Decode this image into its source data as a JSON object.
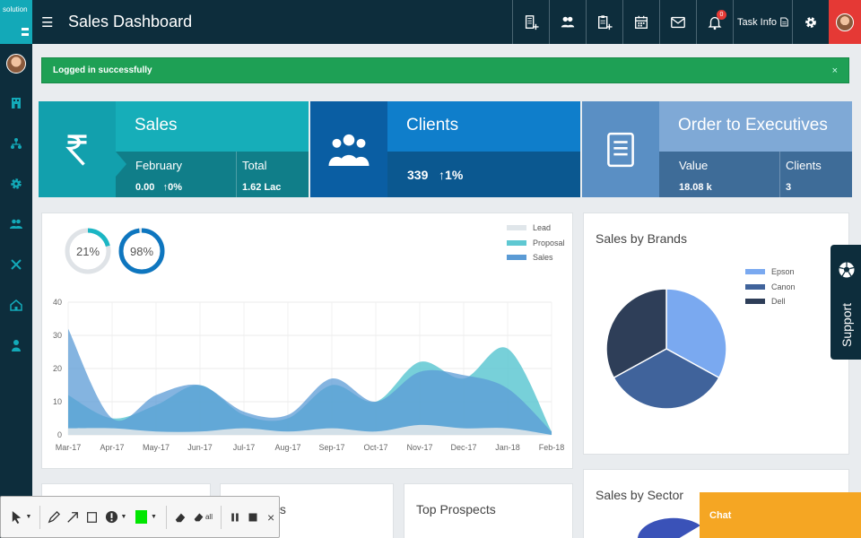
{
  "app": {
    "logo_text": "solution",
    "title": "Sales Dashboard",
    "task_info_label": "Task Info",
    "notification_count": "0"
  },
  "alert": {
    "message": "Logged in successfully",
    "close": "×"
  },
  "kpis": {
    "sales": {
      "title": "Sales",
      "col1_label": "February",
      "col1_value": "0.00",
      "col1_change": "0%",
      "col2_label": "Total",
      "col2_value": "1.62 Lac"
    },
    "clients": {
      "title": "Clients",
      "value": "339",
      "change": "1%"
    },
    "orders": {
      "title": "Order to Executives",
      "col1_label": "Value",
      "col1_value": "18.08 k",
      "col2_label": "Clients",
      "col2_value": "3"
    }
  },
  "gauges": [
    {
      "label": "21%",
      "value": 21,
      "color": "#1bb6c4"
    },
    {
      "label": "98%",
      "value": 98,
      "color": "#0e76bf"
    }
  ],
  "chart_data": [
    {
      "type": "area",
      "categories": [
        "Mar-17",
        "Apr-17",
        "May-17",
        "Jun-17",
        "Jul-17",
        "Aug-17",
        "Sep-17",
        "Oct-17",
        "Nov-17",
        "Dec-17",
        "Jan-18",
        "Feb-18"
      ],
      "series": [
        {
          "name": "Lead",
          "color": "#e0e6ea",
          "values": [
            2,
            2,
            1,
            1,
            2,
            1,
            2,
            1,
            3,
            2,
            2,
            0
          ]
        },
        {
          "name": "Proposal",
          "color": "#5fc8d2",
          "values": [
            12,
            5,
            9,
            15,
            6,
            5,
            15,
            10,
            22,
            17,
            26,
            1
          ]
        },
        {
          "name": "Sales",
          "color": "#5b9bd5",
          "values": [
            32,
            5,
            12,
            15,
            7,
            6,
            17,
            10,
            19,
            18,
            14,
            1
          ]
        }
      ],
      "ylim": [
        0,
        40
      ],
      "yticks": [
        0,
        10,
        20,
        30,
        40
      ],
      "grid": true,
      "legend": "top-right"
    },
    {
      "type": "pie",
      "title": "Sales by Brands",
      "categories": [
        "Epson",
        "Canon",
        "Dell"
      ],
      "values": [
        33,
        34,
        33
      ],
      "colors": [
        "#7aa9f0",
        "#40639b",
        "#2e3e58"
      ],
      "legend": "right"
    }
  ],
  "panels": {
    "sector_title": "Sales by Sector",
    "prospects_title": "Top Prospects",
    "partial_b": "ts"
  },
  "support_label": "Support",
  "chat_label": "Chat",
  "toolbar": {
    "erase_all": "all",
    "close": "×",
    "pen_color": "#00e600"
  }
}
